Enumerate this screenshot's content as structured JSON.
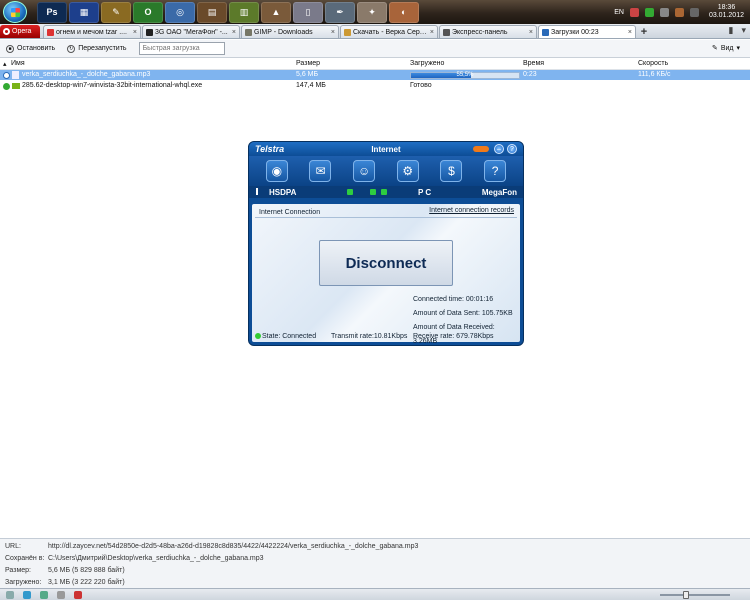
{
  "taskbar": {
    "language": "EN",
    "time": "18:36",
    "date": "03.01.2012",
    "icons": [
      "photoshop-icon",
      "film-icon",
      "tools-icon",
      "opera-icon",
      "chrome-icon",
      "archiver-icon",
      "notepad-icon",
      "vlc-icon",
      "word-icon",
      "ink-icon",
      "gimp-icon",
      "fox-icon"
    ]
  },
  "tabs": {
    "opera_menu": "Opera",
    "items": [
      {
        "label": "огнем и мечом tzar ....",
        "close": "×"
      },
      {
        "label": "3G ОАО \"МегаФон\" -...",
        "close": "×"
      },
      {
        "label": "GIMP - Downloads",
        "close": "×"
      },
      {
        "label": "Скачать - Верка Серд...",
        "close": "×"
      },
      {
        "label": "Экспресс-панель",
        "close": "×"
      },
      {
        "label": "Загрузки 00:23",
        "close": "×"
      }
    ],
    "new_tab": "+"
  },
  "toolbar": {
    "stop_label": "Остановить",
    "restart_label": "Перезапустить",
    "quick_placeholder": "Быстрая загрузка",
    "view_label": "Вид"
  },
  "table": {
    "headers": {
      "name": "Имя",
      "size": "Размер",
      "loaded": "Загружено",
      "time": "Время",
      "speed": "Скорость"
    },
    "rows": [
      {
        "name": "verka_serdiuchka_-_dolche_gabana.mp3",
        "size": "5,6 МБ",
        "loaded_text": "55,5%",
        "progress": 0.555,
        "time": "0:23",
        "speed": "111,6 КБ/с"
      },
      {
        "name": "285.62-desktop-win7-winvista-32bit-international-whql.exe",
        "size": "147,4 МБ",
        "loaded_text": "Готово",
        "time": "",
        "speed": ""
      }
    ]
  },
  "telstra": {
    "logo": "Telstra",
    "title": "Internet",
    "help": "?",
    "minimize": "–",
    "network_type": "HSDPA",
    "pc_label": "P C",
    "operator": "MegaFon",
    "connection_title": "Internet Connection",
    "records_link": "Internet connection records",
    "disconnect_label": "Disconnect",
    "connected_time": "Connected time:  00:01:16",
    "data_sent": "Amount of Data Sent:  105.75KB",
    "data_received": "Amount of Data Received:  3.26MB",
    "state": "State: Connected",
    "transmit_rate": "Transmit rate:10.81Kbps",
    "receive_rate": "Receive rate:  679.78Kbps"
  },
  "details": {
    "url_label": "URL:",
    "url_value": "http://dl.zaycev.net/54d2850e-d2d5-48ba-a26d-d19828c8d835/4422/4422224/verka_serdiuchka_-_dolche_gabana.mp3",
    "saved_label": "Сохранён в:",
    "saved_value": "C:\\Users\\Дмитрий\\Desktop\\verka_serdiuchka_-_dolche_gabana.mp3",
    "size_label": "Размер:",
    "size_value": "5,6 МБ (5 829 888 байт)",
    "loaded_label": "Загружено:",
    "loaded_value": "3,1 МБ (3 222 220 байт)"
  },
  "colors": {
    "selection": "#7fb4ef",
    "telstra_blue": "#0d4d96",
    "progress": "#1e64c0"
  }
}
